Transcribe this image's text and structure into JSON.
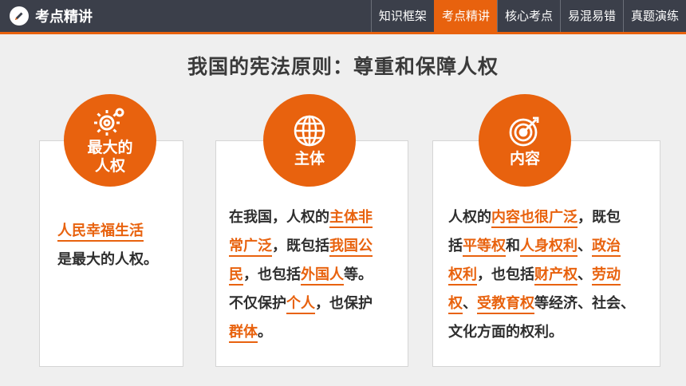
{
  "header": {
    "title": "考点精讲",
    "tabs": [
      {
        "label": "知识框架",
        "active": false
      },
      {
        "label": "考点精讲",
        "active": true
      },
      {
        "label": "核心考点",
        "active": false
      },
      {
        "label": "易混易错",
        "active": false
      },
      {
        "label": "真题演练",
        "active": false
      }
    ]
  },
  "headline": "我国的宪法原则：尊重和保障人权",
  "colors": {
    "accent": "#e8620e",
    "topbar": "#3b3f4a"
  },
  "cards": [
    {
      "icon": "gear-icon",
      "circle_line1": "最大的",
      "circle_line2": "人权",
      "lines": [
        [
          {
            "t": "人民幸福生活",
            "hl": true
          }
        ],
        [
          {
            "t": "是最大的人权。",
            "hl": false
          }
        ]
      ]
    },
    {
      "icon": "globe-icon",
      "circle_label": "主体",
      "lines": [
        [
          {
            "t": "在我国，人权的",
            "hl": false
          },
          {
            "t": "主体非",
            "hl": true
          }
        ],
        [
          {
            "t": "常广泛",
            "hl": true
          },
          {
            "t": "，既包括",
            "hl": false
          },
          {
            "t": "我国公",
            "hl": true
          }
        ],
        [
          {
            "t": "民",
            "hl": true
          },
          {
            "t": "，也包括",
            "hl": false
          },
          {
            "t": "外国人",
            "hl": true
          },
          {
            "t": "等。",
            "hl": false
          }
        ],
        [
          {
            "t": "不仅保护",
            "hl": false
          },
          {
            "t": "个人",
            "hl": true
          },
          {
            "t": "，也保护",
            "hl": false
          }
        ],
        [
          {
            "t": "群体",
            "hl": true
          },
          {
            "t": "。",
            "hl": false
          }
        ]
      ]
    },
    {
      "icon": "target-icon",
      "circle_label": "内容",
      "lines": [
        [
          {
            "t": "人权的",
            "hl": false
          },
          {
            "t": "内容也很广泛",
            "hl": true
          },
          {
            "t": "，既包",
            "hl": false
          }
        ],
        [
          {
            "t": "括",
            "hl": false
          },
          {
            "t": "平等权",
            "hl": true
          },
          {
            "t": "和",
            "hl": false
          },
          {
            "t": "人身权利",
            "hl": true
          },
          {
            "t": "、",
            "hl": false
          },
          {
            "t": "政治",
            "hl": true
          }
        ],
        [
          {
            "t": "权利",
            "hl": true
          },
          {
            "t": "，也包括",
            "hl": false
          },
          {
            "t": "财产权",
            "hl": true
          },
          {
            "t": "、",
            "hl": false
          },
          {
            "t": "劳动",
            "hl": true
          }
        ],
        [
          {
            "t": "权",
            "hl": true
          },
          {
            "t": "、",
            "hl": false
          },
          {
            "t": "受教育权",
            "hl": true
          },
          {
            "t": "等经济、社会、",
            "hl": false
          }
        ],
        [
          {
            "t": "文化方面的权利。",
            "hl": false
          }
        ]
      ]
    }
  ]
}
